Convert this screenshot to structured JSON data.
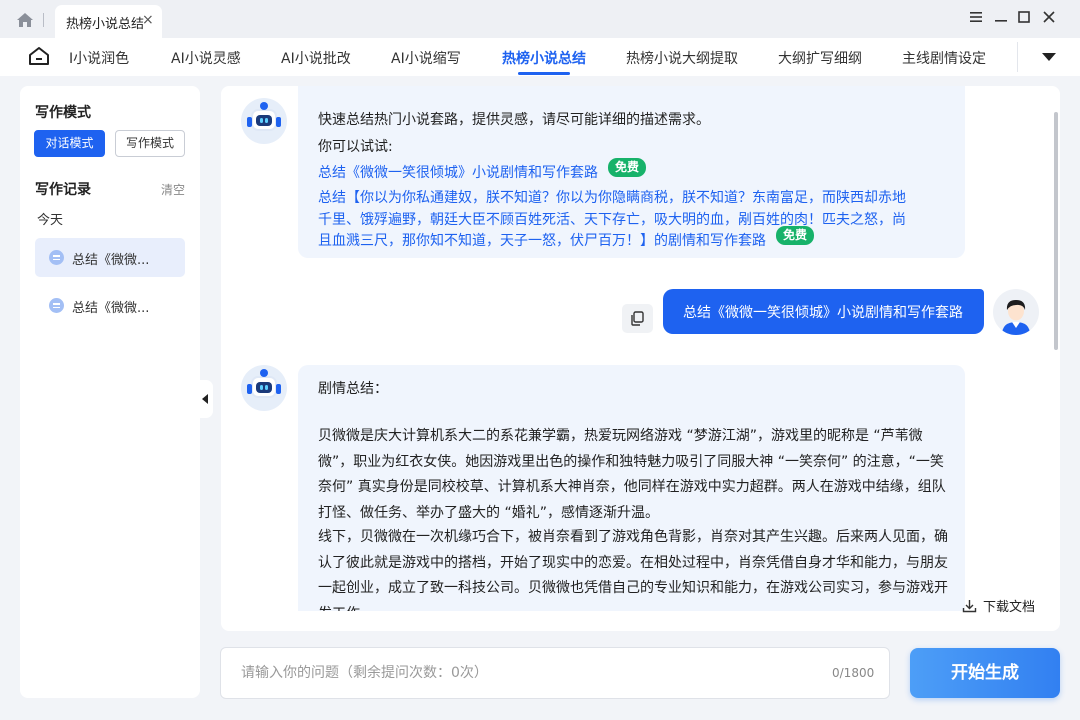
{
  "titlebar": {
    "tab_label": "热榜小说总结",
    "tab_close": "×",
    "icons": [
      "home-icon",
      "menu-icon",
      "minimize-icon",
      "maximize-icon",
      "close-icon"
    ]
  },
  "nav": {
    "items": [
      {
        "label": "I小说润色"
      },
      {
        "label": "AI小说灵感"
      },
      {
        "label": "AI小说批改"
      },
      {
        "label": "AI小说缩写"
      },
      {
        "label": "热榜小说总结"
      },
      {
        "label": "热榜小说大纲提取"
      },
      {
        "label": "大纲扩写细纲"
      },
      {
        "label": "主线剧情设定"
      }
    ],
    "active_index": 4
  },
  "sidebar": {
    "mode_title": "写作模式",
    "modes": [
      {
        "label": "对话模式"
      },
      {
        "label": "写作模式"
      }
    ],
    "active_mode": 0,
    "records_title": "写作记录",
    "clear_label": "清空",
    "today_label": "今天",
    "history": [
      {
        "label": "总结《微微一笑很倾城》小说剧情和写作套路"
      },
      {
        "label": "总结《微微一笑很倾城》小说剧情和写作套路"
      }
    ]
  },
  "chat": {
    "intro": {
      "line1": "快速总结热门小说套路，提供灵感，请尽可能详细的描述需求。",
      "line2": "你可以试试:",
      "suggest1": "总结《微微一笑很倾城》小说剧情和写作套路",
      "suggest2_lines": [
        "总结【你以为你私通建奴，朕不知道？你以为你隐瞒商税，朕不知道？东南富足，而陕西却赤地",
        "千里、饿殍遍野，朝廷大臣不顾百姓死活、天下存亡，吸大明的血，剐百姓的肉！匹夫之怒，尚",
        "且血溅三尺，那你知不知道，天子一怒，伏尸百万！】的剧情和写作套路"
      ],
      "badge": "免费"
    },
    "user_message": "总结《微微一笑很倾城》小说剧情和写作套路",
    "response": {
      "heading": "剧情总结：",
      "para1": "贝微微是庆大计算机系大二的系花兼学霸，热爱玩网络游戏 “梦游江湖”，游戏里的昵称是 “芦苇微微”，职业为红衣女侠。她因游戏里出色的操作和独特魅力吸引了同服大神 “一笑奈何” 的注意，“一笑奈何” 真实身份是同校校草、计算机系大神肖奈，他同样在游戏中实力超群。两人在游戏中结缘，组队打怪、做任务、举办了盛大的 “婚礼”，感情逐渐升温。",
      "para2": "线下，贝微微在一次机缘巧合下，被肖奈看到了游戏角色背影，肖奈对其产生兴趣。后来两人见面，确认了彼此就是游戏中的搭档，开始了现实中的恋爱。在相处过程中，肖奈凭借自身才华和能力，与朋友一起创业，成立了致一科技公司。贝微微也凭借自己的专业知识和能力，在游戏公司实习，参与游戏开发工作。"
    },
    "download_label": "下载文档"
  },
  "input": {
    "placeholder": "请输入你的问题（剩余提问次数：0次）",
    "value": "",
    "counter": "0/1800"
  },
  "generate_label": "开始生成",
  "colors": {
    "accent": "#1e62f0",
    "badge": "#17b26a",
    "bot_bubble": "#f0f5fd"
  }
}
